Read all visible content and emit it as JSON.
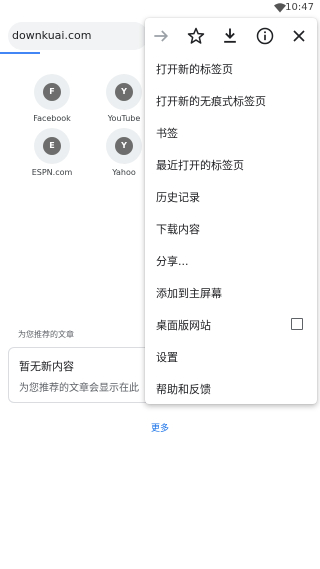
{
  "status_bar": {
    "time": "10:47",
    "wifi_icon": "wifi-icon"
  },
  "toolbar": {
    "url": "downkuai.com"
  },
  "tiles": [
    {
      "letter": "F",
      "label": "Facebook"
    },
    {
      "letter": "Y",
      "label": "YouTube"
    },
    {
      "letter": "E",
      "label": "ESPN.com"
    },
    {
      "letter": "Y",
      "label": "Yahoo"
    }
  ],
  "articles": {
    "section_header": "为您推荐的文章",
    "card_title": "暂无新内容",
    "card_subtitle": "为您推荐的文章会显示在此",
    "more_label": "更多"
  },
  "menu": {
    "icons": [
      "forward-icon",
      "bookmark-star-icon",
      "download-icon",
      "info-icon",
      "close-icon"
    ],
    "items": [
      {
        "label": "打开新的标签页"
      },
      {
        "label": "打开新的无痕式标签页"
      },
      {
        "label": "书签"
      },
      {
        "label": "最近打开的标签页"
      },
      {
        "label": "历史记录"
      },
      {
        "label": "下载内容"
      },
      {
        "label": "分享..."
      },
      {
        "label": "添加到主屏幕"
      },
      {
        "label": "桌面版网站",
        "checkbox": false
      },
      {
        "label": "设置"
      },
      {
        "label": "帮助和反馈"
      }
    ]
  },
  "colors": {
    "accent": "#1a73e8",
    "progress": "#4285f4",
    "tile_badge": "#6d6d6d"
  }
}
